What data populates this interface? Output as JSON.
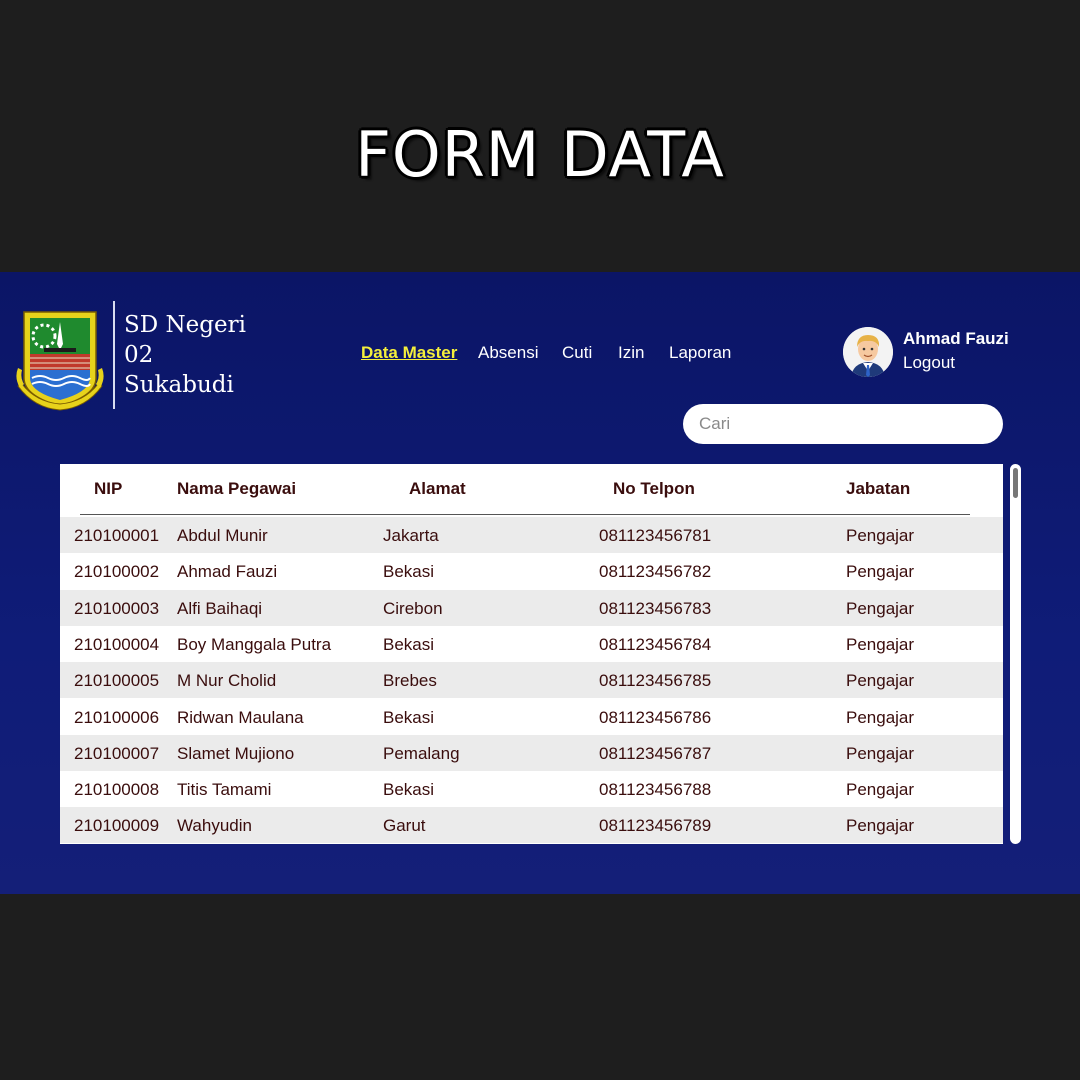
{
  "page_title": "FORM DATA",
  "brand": {
    "name": "SD Negeri\n02\nSukabudi",
    "logo_icon": "regional-crest-logo"
  },
  "nav": [
    {
      "label": "Data Master",
      "active": true
    },
    {
      "label": "Absensi",
      "active": false
    },
    {
      "label": "Cuti",
      "active": false
    },
    {
      "label": "Izin",
      "active": false
    },
    {
      "label": "Laporan",
      "active": false
    }
  ],
  "user": {
    "name": "Ahmad Fauzi",
    "logout_label": "Logout",
    "avatar_icon": "user-avatar-icon"
  },
  "search": {
    "placeholder": "Cari",
    "value": ""
  },
  "table": {
    "headers": [
      "NIP",
      "Nama Pegawai",
      "Alamat",
      "No Telpon",
      "Jabatan"
    ],
    "rows": [
      [
        "210100001",
        "Abdul Munir",
        "Jakarta",
        "081123456781",
        "Pengajar"
      ],
      [
        "210100002",
        "Ahmad Fauzi",
        "Bekasi",
        "081123456782",
        "Pengajar"
      ],
      [
        "210100003",
        "Alfi Baihaqi",
        "Cirebon",
        "081123456783",
        "Pengajar"
      ],
      [
        "210100004",
        "Boy Manggala Putra",
        "Bekasi",
        "081123456784",
        "Pengajar"
      ],
      [
        "210100005",
        "M Nur Cholid",
        "Brebes",
        "081123456785",
        "Pengajar"
      ],
      [
        "210100006",
        "Ridwan Maulana",
        "Bekasi",
        "081123456786",
        "Pengajar"
      ],
      [
        "210100007",
        "Slamet Mujiono",
        "Pemalang",
        "081123456787",
        "Pengajar"
      ],
      [
        "210100008",
        "Titis Tamami",
        "Bekasi",
        "081123456788",
        "Pengajar"
      ],
      [
        "210100009",
        "Wahyudin",
        "Garut",
        "081123456789",
        "Pengajar"
      ]
    ]
  },
  "colors": {
    "background": "#1e1e1e",
    "app_background": "#0f1c78",
    "nav_active": "#f4ee3c",
    "table_text": "#3a0d0d",
    "row_alt": "#ebebeb"
  }
}
